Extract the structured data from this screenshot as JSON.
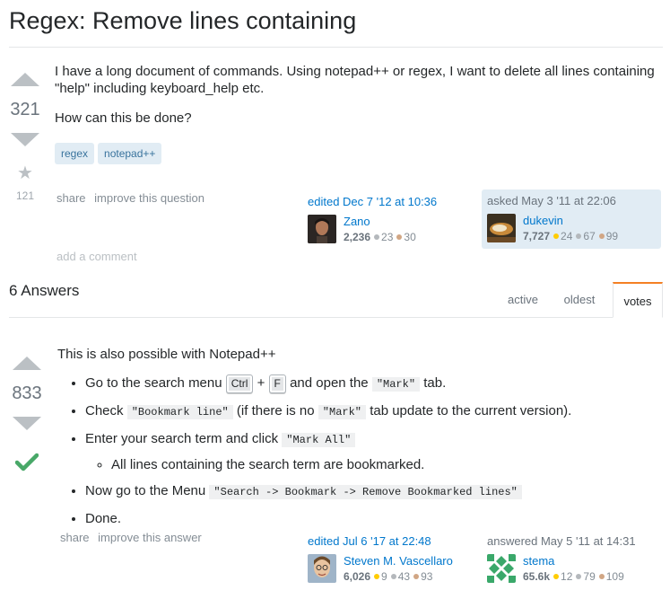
{
  "question": {
    "title": "Regex: Remove lines containing",
    "votes": "321",
    "favorites": "121",
    "body": [
      "I have a long document of commands. Using notepad++ or regex, I want to delete all lines containing \"help\" including keyboard_help etc.",
      "How can this be done?"
    ],
    "tags": [
      "regex",
      "notepad++"
    ],
    "menu": {
      "share": "share",
      "improve": "improve this question"
    },
    "edited": {
      "action": "edited Dec 7 '12 at 10:36",
      "user": "Zano",
      "rep": "2,236",
      "silver": "23",
      "bronze": "30"
    },
    "asked": {
      "action": "asked May 3 '11 at 22:06",
      "user": "dukevin",
      "rep": "7,727",
      "gold": "24",
      "silver": "67",
      "bronze": "99"
    },
    "add_comment": "add a comment"
  },
  "answers_header": {
    "count_label": "6 Answers",
    "tabs": [
      "active",
      "oldest",
      "votes"
    ],
    "selected_tab": "votes"
  },
  "answer": {
    "votes": "833",
    "intro": "This is also possible with Notepad++",
    "steps": {
      "s1_pre": "Go to the search menu",
      "s1_key1": "Ctrl",
      "s1_plus": "+",
      "s1_key2": "F",
      "s1_mid": "and open the",
      "s1_code": "\"Mark\"",
      "s1_post": "tab.",
      "s2_pre": "Check",
      "s2_code1": "\"Bookmark line\"",
      "s2_mid": "(if there is no",
      "s2_code2": "\"Mark\"",
      "s2_post": "tab update to the current version).",
      "s3_pre": "Enter your search term and click",
      "s3_code": "\"Mark All\"",
      "s3_sub": "All lines containing the search term are bookmarked.",
      "s4_pre": "Now go to the Menu",
      "s4_code": "\"Search -> Bookmark -> Remove Bookmarked lines\"",
      "s5": "Done."
    },
    "menu": {
      "share": "share",
      "improve": "improve this answer"
    },
    "edited": {
      "action": "edited Jul 6 '17 at 22:48",
      "user": "Steven M. Vascellaro",
      "rep": "6,026",
      "gold": "9",
      "silver": "43",
      "bronze": "93"
    },
    "answered": {
      "action": "answered May 5 '11 at 14:31",
      "user": "stema",
      "rep": "65.6k",
      "gold": "12",
      "silver": "79",
      "bronze": "109"
    }
  },
  "colors": {
    "link": "#0077cc",
    "accepted": "#48a868",
    "tag_bg": "#e1ecf4",
    "tab_accent": "#f48024"
  },
  "icons": [
    "upvote-icon",
    "downvote-icon",
    "star-icon",
    "accepted-check-icon"
  ]
}
